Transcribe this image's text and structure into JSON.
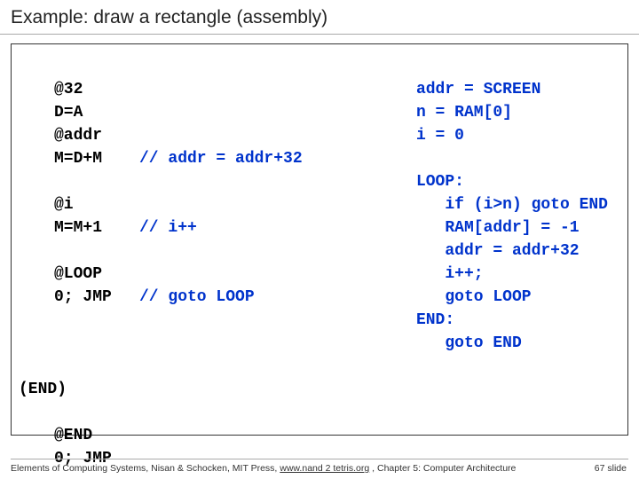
{
  "title": "Example: draw a rectangle (assembly)",
  "asm": {
    "l1": "@32",
    "l2": "D=A",
    "l3": "@addr",
    "l4": "M=D+M",
    "c4": "// addr = addr+32",
    "l5": "@i",
    "l6": "M=M+1",
    "c6": "// i++",
    "l7": "@LOOP",
    "l8": "0; JMP",
    "c8": "// goto LOOP",
    "l9": "@END",
    "l10": "0; JMP"
  },
  "endLabel": "(END)",
  "pseudo": {
    "p1": "addr = SCREEN",
    "p2": "n = RAM[0]",
    "p3": "i = 0",
    "p4": "",
    "p5": "LOOP:",
    "p6": "   if (i>n) goto END",
    "p7": "   RAM[addr] = -1",
    "p8": "   addr = addr+32",
    "p9": "   i++;",
    "p10": "   goto LOOP",
    "p11": "END:",
    "p12": "   goto END"
  },
  "footer": {
    "left": "Elements of Computing Systems, Nisan & Schocken, MIT Press, ",
    "link": "www.nand 2 tetris.org",
    "right": " , Chapter 5: Computer Architecture",
    "page": "67 slide"
  }
}
